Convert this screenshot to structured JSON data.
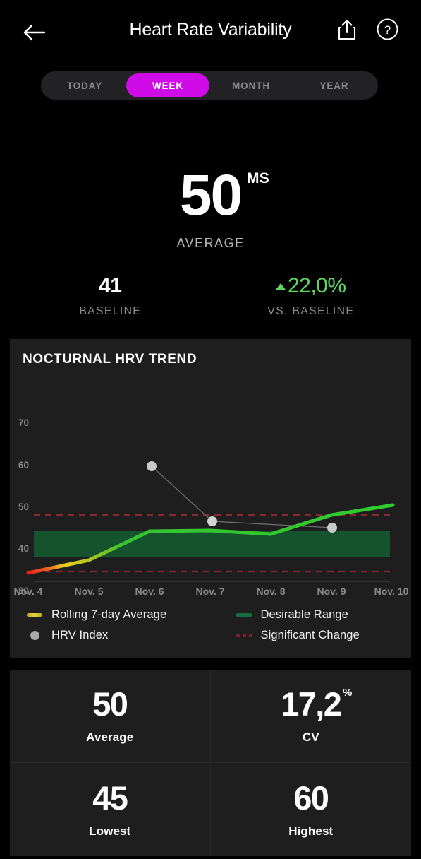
{
  "header": {
    "title": "Heart Rate Variability",
    "back_icon": "arrow-left-icon",
    "share_icon": "share-icon",
    "help_icon": "question-mark-circle-icon"
  },
  "range_tabs": {
    "items": [
      {
        "label": "TODAY",
        "active": false
      },
      {
        "label": "WEEK",
        "active": true
      },
      {
        "label": "MONTH",
        "active": false
      },
      {
        "label": "YEAR",
        "active": false
      }
    ],
    "active_color": "#ce0ae6"
  },
  "hero": {
    "value": "50",
    "unit": "MS",
    "label": "AVERAGE"
  },
  "sub_stats": [
    {
      "value": "41",
      "label": "BASELINE",
      "positive": false
    },
    {
      "value": "22,0%",
      "label": "VS. BASELINE",
      "positive": true,
      "trend_icon": "caret-up-icon",
      "color": "#5fd663"
    }
  ],
  "chart_card": {
    "title": "NOCTURNAL HRV TREND"
  },
  "legend": [
    {
      "label": "Rolling 7-day Average",
      "swatch": "gradient-line-swatch"
    },
    {
      "label": "Desirable Range",
      "swatch": "green-line-swatch"
    },
    {
      "label": "HRV Index",
      "swatch": "grey-dot-swatch"
    },
    {
      "label": "Significant Change",
      "swatch": "red-dashed-swatch"
    }
  ],
  "bottom_stats": [
    {
      "value": "50",
      "sup": "",
      "label": "Average"
    },
    {
      "value": "17,2",
      "sup": "%",
      "label": "CV"
    },
    {
      "value": "45",
      "sup": "",
      "label": "Lowest"
    },
    {
      "value": "60",
      "sup": "",
      "label": "Highest"
    }
  ],
  "chart_data": {
    "type": "line",
    "title": "NOCTURNAL HRV TREND",
    "xlabel": "",
    "ylabel": "",
    "ylim": [
      27,
      73
    ],
    "yticks": [
      30,
      40,
      50,
      60,
      70
    ],
    "grid": false,
    "legend_position": "below",
    "categories": [
      "Nov. 4",
      "Nov. 5",
      "Nov. 6",
      "Nov. 7",
      "Nov. 8",
      "Nov. 9",
      "Nov. 10"
    ],
    "series": [
      {
        "name": "Rolling 7-day Average",
        "type": "line",
        "color_gradient": [
          "#e02020",
          "#e8d21c",
          "#2ecc2e",
          "#2ecc2e",
          "#2ecc2e",
          "#2ecc2e",
          "#2ecc2e"
        ],
        "values": [
          34.7,
          37.5,
          44.3,
          44.5,
          43.7,
          47.8,
          50.3
        ]
      },
      {
        "name": "HRV Index",
        "type": "scatter",
        "color": "#c8c8c8",
        "x": [
          "Nov. 6",
          "Nov. 7",
          "Nov. 9"
        ],
        "values": [
          60,
          47,
          45
        ]
      }
    ],
    "bands": [
      {
        "name": "Desirable Range",
        "color": "#13512f",
        "y_from": 38.2,
        "y_to": 44.3
      }
    ],
    "reference_lines": [
      {
        "name": "Significant Change (upper)",
        "y": 48,
        "color": "#7e2230",
        "style": "dashed"
      },
      {
        "name": "Significant Change (lower)",
        "y": 34.5,
        "color": "#7e2230",
        "style": "dashed"
      }
    ]
  }
}
